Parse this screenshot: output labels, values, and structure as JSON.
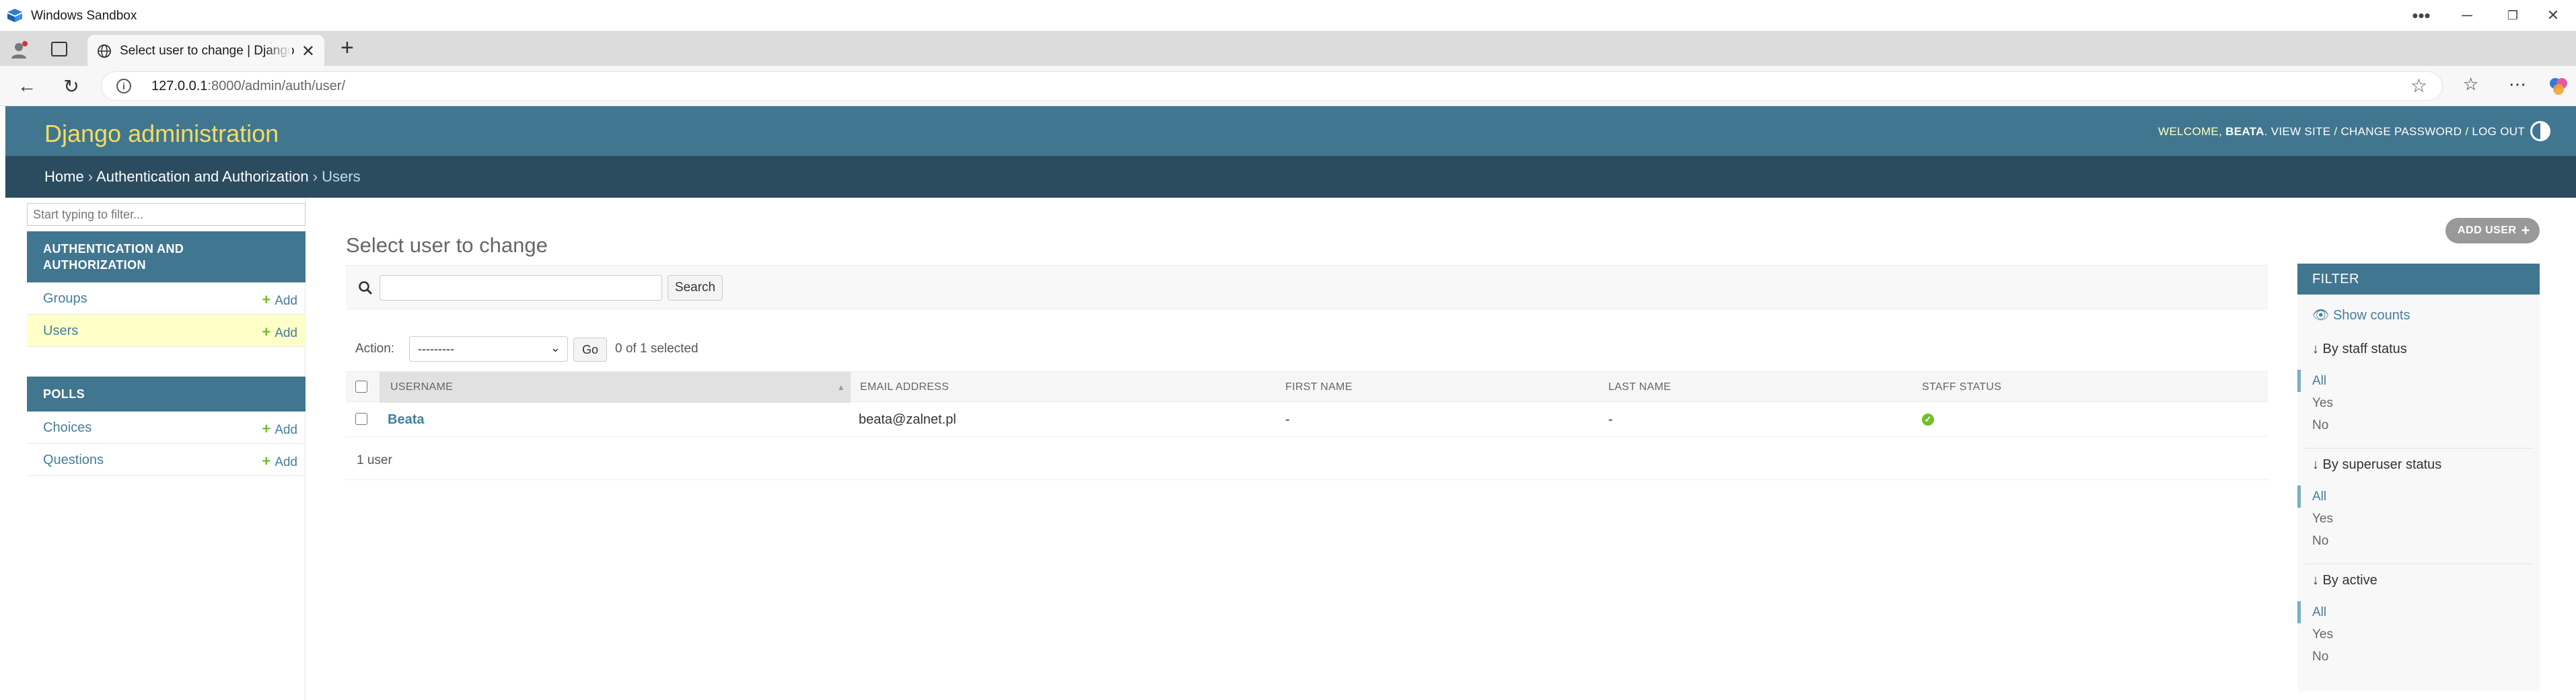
{
  "window": {
    "title": "Windows Sandbox"
  },
  "browser": {
    "tab_title": "Select user to change | Django site admin",
    "url_host": "127.0.0.1",
    "url_rest": ":8000/admin/auth/user/"
  },
  "header": {
    "brand": "Django administration",
    "welcome": "Welcome,",
    "username": "Beata",
    "view_site": "View site",
    "change_password": "Change password",
    "log_out": "Log out",
    "sep": " / "
  },
  "breadcrumbs": {
    "home": "Home",
    "app": "Authentication and Authorization",
    "current": "Users",
    "sep": " › "
  },
  "sidebar": {
    "filter_placeholder": "Start typing to filter...",
    "modules": [
      {
        "caption": "Authentication and Authorization",
        "models": [
          {
            "name": "Groups",
            "add": "Add"
          },
          {
            "name": "Users",
            "add": "Add"
          }
        ]
      },
      {
        "caption": "Polls",
        "models": [
          {
            "name": "Choices",
            "add": "Add"
          },
          {
            "name": "Questions",
            "add": "Add"
          }
        ]
      }
    ]
  },
  "main": {
    "title": "Select user to change",
    "add_button": "Add user",
    "search_button": "Search",
    "action_label": "Action:",
    "action_selected": "---------",
    "go_button": "Go",
    "action_counter": "0 of 1 selected",
    "columns": [
      "Username",
      "Email address",
      "First name",
      "Last name",
      "Staff status"
    ],
    "rows": [
      {
        "username": "Beata",
        "email": "beata@zalnet.pl",
        "first_name": "-",
        "last_name": "-",
        "staff_status": true
      }
    ],
    "paginator": "1 user"
  },
  "filter": {
    "title": "Filter",
    "show_counts": "Show counts",
    "groups": [
      {
        "title": "↓ By staff status",
        "options": [
          "All",
          "Yes",
          "No"
        ],
        "selected": "All"
      },
      {
        "title": "↓ By superuser status",
        "options": [
          "All",
          "Yes",
          "No"
        ],
        "selected": "All"
      },
      {
        "title": "↓ By active",
        "options": [
          "All",
          "Yes",
          "No"
        ],
        "selected": "All"
      }
    ]
  },
  "colors": {
    "header": "#417690",
    "breadcrumbs": "#2b4c5f",
    "brand": "#f5dd5d",
    "link": "#447e9b",
    "add_green": "#70bf2b"
  }
}
